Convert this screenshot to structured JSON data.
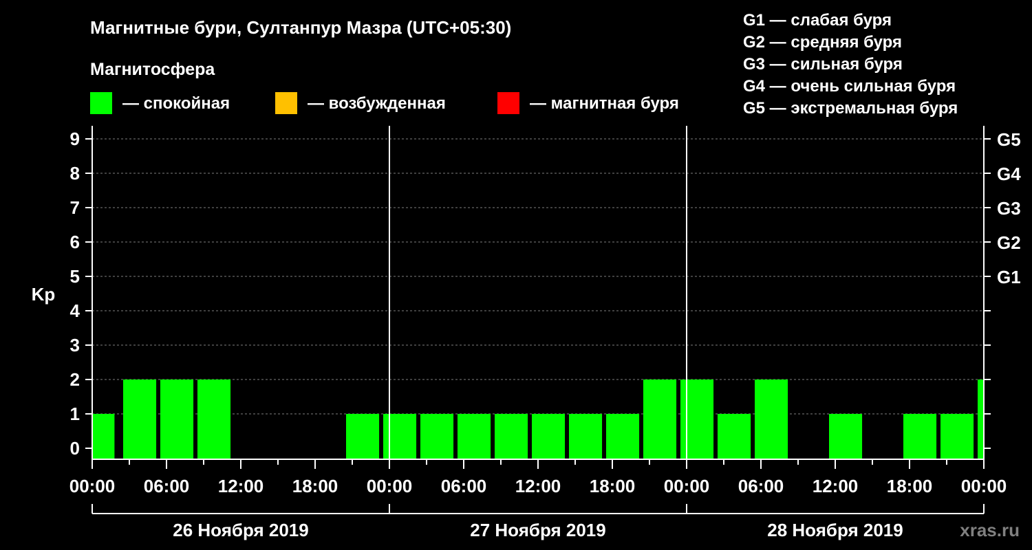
{
  "chart_data": {
    "type": "bar",
    "title": "Магнитные бури, Султанпур Мазра (UTC+05:30)",
    "subtitle": "Магнитосфера",
    "ylabel": "Kp",
    "ylim": [
      0,
      9
    ],
    "yticks": [
      "0",
      "1",
      "2",
      "3",
      "4",
      "5",
      "6",
      "7",
      "8",
      "9"
    ],
    "xlim_hours": [
      0,
      72
    ],
    "xticks": [
      "00:00",
      "06:00",
      "12:00",
      "18:00",
      "00:00",
      "06:00",
      "12:00",
      "18:00",
      "00:00",
      "06:00",
      "12:00",
      "18:00",
      "00:00"
    ],
    "days": [
      "26 Ноября 2019",
      "27 Ноября 2019",
      "28 Ноября 2019"
    ],
    "grid": true,
    "legend": [
      {
        "label": "— спокойная",
        "color": "#00ff00"
      },
      {
        "label": "— возбужденная",
        "color": "#ffc000"
      },
      {
        "label": "— магнитная буря",
        "color": "#ff0000"
      }
    ],
    "storm_scale": [
      "G1 — слабая буря",
      "G2 — средняя буря",
      "G3 — сильная буря",
      "G4 — очень сильная буря",
      "G5 — экстремальная буря"
    ],
    "right_axis": [
      {
        "label": "G1",
        "kp": 5
      },
      {
        "label": "G2",
        "kp": 6
      },
      {
        "label": "G3",
        "kp": 7
      },
      {
        "label": "G4",
        "kp": 8
      },
      {
        "label": "G5",
        "kp": 9
      }
    ],
    "bar_color": "#00ff00",
    "series": [
      {
        "x_hours": [
          0,
          2.5,
          5.5,
          8.5,
          11.5,
          14.5,
          17.5,
          20.5,
          23.5,
          26.5,
          29.5,
          32.5,
          35.5,
          38.5,
          41.5,
          44.5,
          47.5,
          50.5,
          53.5,
          56.5,
          59.5,
          62.5,
          65.5,
          68.5,
          71.5
        ],
        "x_end_hours": [
          1.8,
          5.17,
          8.17,
          11.17,
          14.17,
          17.17,
          20.17,
          23.17,
          26.17,
          29.17,
          32.17,
          35.17,
          38.17,
          41.17,
          44.17,
          47.17,
          50.17,
          53.17,
          56.17,
          59.17,
          62.17,
          65.17,
          68.17,
          71.17,
          72
        ],
        "values": [
          1,
          2,
          2,
          2,
          0,
          0,
          0,
          1,
          1,
          1,
          1,
          1,
          1,
          1,
          1,
          2,
          2,
          1,
          2,
          0,
          1,
          0,
          1,
          1,
          2
        ]
      }
    ]
  },
  "watermark": "xras.ru"
}
